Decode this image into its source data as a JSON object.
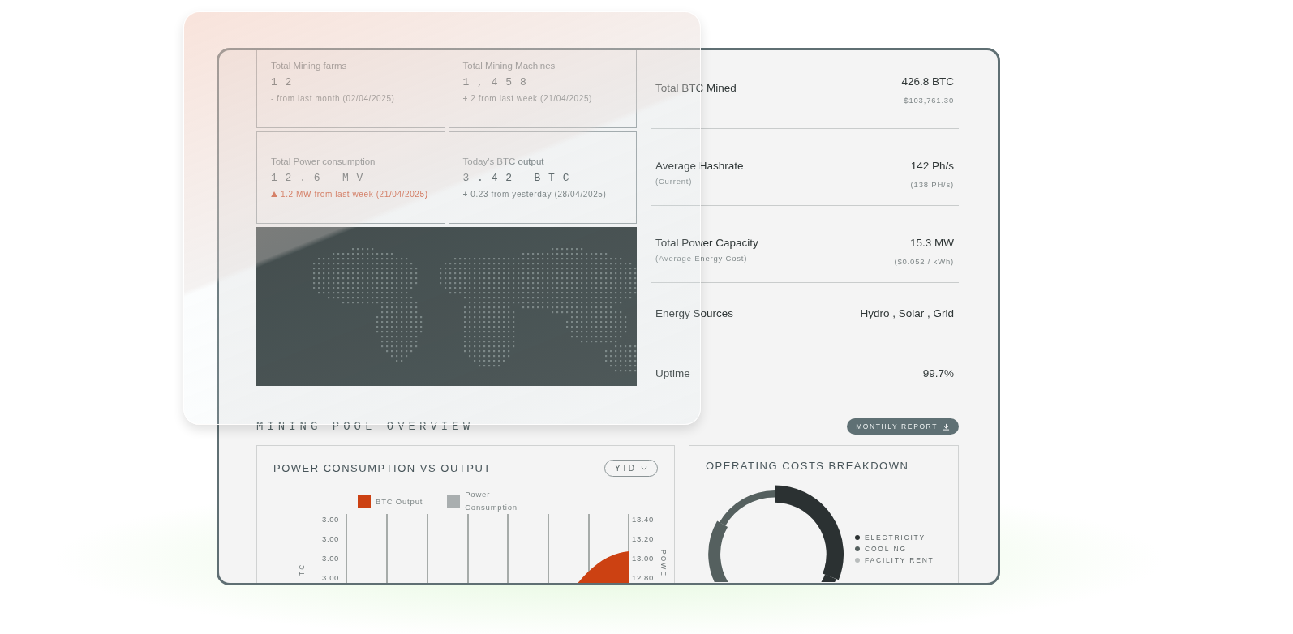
{
  "kpi_cards": [
    {
      "label": "Total Mining farms",
      "value": "1 2",
      "delta": "- from last month (02/04/2025)",
      "alert": false
    },
    {
      "label": "Total Mining Machines",
      "value": "1 , 4 5 8",
      "delta": "+ 2 from last week (21/04/2025)",
      "alert": false
    },
    {
      "label": "Total Power consumption",
      "value": "1 2 . 6   M V",
      "delta": "1.2 MW from last week (21/04/2025)",
      "alert": true
    },
    {
      "label": "Today's BTC output",
      "value": "3 . 4 2   B T C",
      "delta": "+ 0.23 from yesterday (28/04/2025)",
      "alert": false
    }
  ],
  "stats": [
    {
      "label": "Total BTC Mined",
      "value": "426.8 BTC",
      "subvalue": "$103,761.30"
    },
    {
      "label": "Average Hashrate",
      "sublabel": "(Current)",
      "value": "142 Ph/s",
      "subvalue": "(138 PH/s)"
    },
    {
      "label": "Total Power Capacity",
      "sublabel": "(Average Energy Cost)",
      "value": "15.3 MW",
      "subvalue": "($0.052 / kWh)"
    },
    {
      "label": "Energy Sources",
      "value": "Hydro , Solar , Grid"
    },
    {
      "label": "Uptime",
      "value": "99.7%"
    }
  ],
  "section_title": "MINING POOL OVERVIEW",
  "report_button": "MONTHLY REPORT",
  "power_chart": {
    "title": "POWER CONSUMPTION VS OUTPUT",
    "period": "YTD",
    "legend": [
      {
        "label": "BTC Output",
        "color": "#cc4112"
      },
      {
        "label": "Power Consumption",
        "color": "#a9aeaf"
      }
    ],
    "left_ticks": [
      "3.00",
      "3.00",
      "3.00",
      "3.00"
    ],
    "right_ticks": [
      "13.40",
      "13.20",
      "13.00",
      "12.80"
    ],
    "left_axis_label": "TC",
    "right_axis_label": "POWE"
  },
  "costs_chart": {
    "title": "OPERATING COSTS BREAKDOWN",
    "legend": [
      {
        "label": "ELECTRICITY",
        "color": "#2b3132"
      },
      {
        "label": "COOLING",
        "color": "#55605f"
      },
      {
        "label": "FACILITY RENT",
        "color": "#b9bdbd"
      }
    ]
  }
}
